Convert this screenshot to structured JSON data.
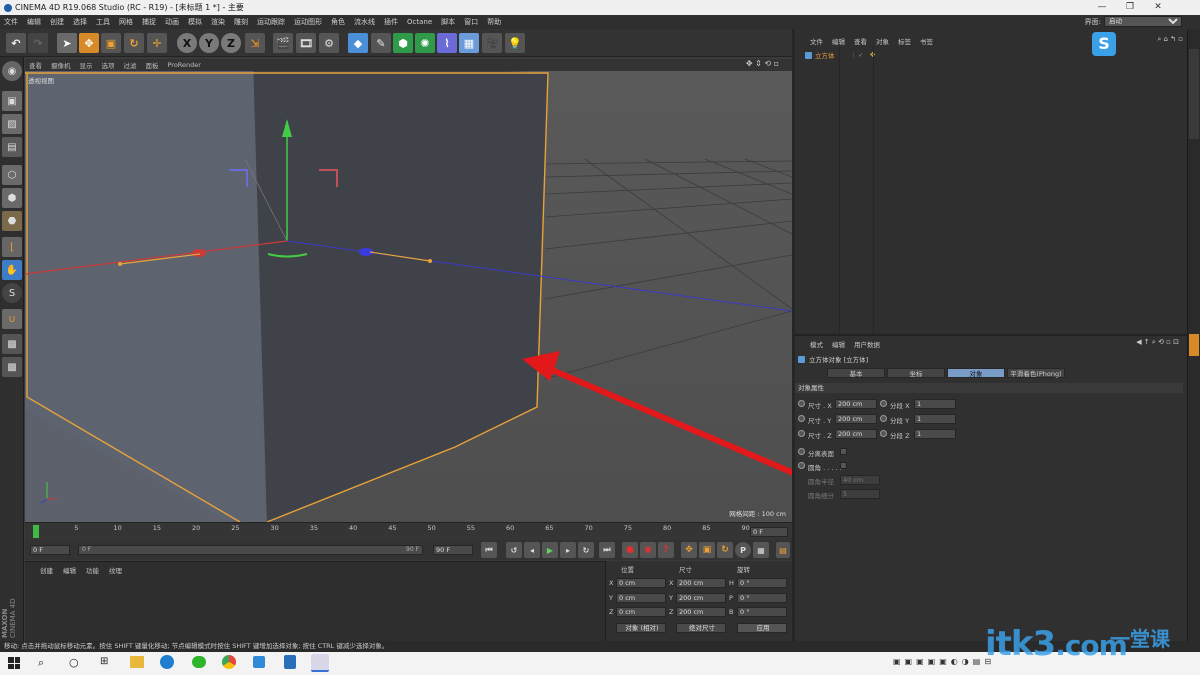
{
  "window": {
    "title": "CINEMA 4D R19.068 Studio (RC - R19) - [未标题 1 *] - 主要"
  },
  "menu": {
    "items": [
      "文件",
      "编辑",
      "创建",
      "选择",
      "工具",
      "网格",
      "捕捉",
      "动画",
      "模拟",
      "渲染",
      "雕刻",
      "运动跟踪",
      "运动图形",
      "角色",
      "流水线",
      "插件",
      "Octane",
      "脚本",
      "窗口",
      "帮助"
    ],
    "interface_label": "界面:",
    "interface_value": "启动"
  },
  "viewport": {
    "menu": [
      "查看",
      "摄像机",
      "显示",
      "选项",
      "过滤",
      "面板",
      "ProRender"
    ],
    "name": "透视视图",
    "grid_label": "网格间距 : 100 cm"
  },
  "timeline": {
    "ticks": [
      "0",
      "5",
      "10",
      "15",
      "20",
      "25",
      "30",
      "35",
      "40",
      "45",
      "50",
      "55",
      "60",
      "65",
      "70",
      "75",
      "80",
      "85",
      "90"
    ],
    "current_frame": "0 F",
    "start_field": "0 F",
    "range_start": "0 F",
    "range_end": "90 F",
    "end_field": "90 F"
  },
  "material": {
    "menu": [
      "创建",
      "编辑",
      "功能",
      "纹理"
    ]
  },
  "coords": {
    "headers": [
      "位置",
      "尺寸",
      "旋转"
    ],
    "rows": [
      {
        "axis": "X",
        "pos": "0 cm",
        "size_axis": "X",
        "size": "200 cm",
        "rot_axis": "H",
        "rot": "0 °"
      },
      {
        "axis": "Y",
        "pos": "0 cm",
        "size_axis": "Y",
        "size": "200 cm",
        "rot_axis": "P",
        "rot": "0 °"
      },
      {
        "axis": "Z",
        "pos": "0 cm",
        "size_axis": "Z",
        "size": "200 cm",
        "rot_axis": "B",
        "rot": "0 °"
      }
    ],
    "mode_select": "对象 (相对)",
    "size_select": "绝对尺寸",
    "apply": "应用"
  },
  "object_manager": {
    "menu": [
      "文件",
      "编辑",
      "查看",
      "对象",
      "标签",
      "书签"
    ],
    "object_name": "立方体"
  },
  "attributes": {
    "menu": [
      "模式",
      "编辑",
      "用户数据"
    ],
    "object_title": "立方体对象 [立方体]",
    "tabs": [
      "基本",
      "坐标",
      "对象",
      "平滑着色(Phong)"
    ],
    "active_tab": 2,
    "section": "对象属性",
    "size_rows": [
      {
        "label": "尺寸 . X",
        "value": "200 cm",
        "seg_label": "分段 X",
        "seg": "1"
      },
      {
        "label": "尺寸 . Y",
        "value": "200 cm",
        "seg_label": "分段 Y",
        "seg": "1"
      },
      {
        "label": "尺寸 . Z",
        "value": "200 cm",
        "seg_label": "分段 Z",
        "seg": "1"
      }
    ],
    "separate_surfaces": "分离表面",
    "fillet": "圆角 . . . . .",
    "fillet_radius": "圆角半径",
    "fillet_radius_value": "40 cm",
    "fillet_subdiv": "圆角细分",
    "fillet_subdiv_value": "5"
  },
  "status": {
    "text": "移动: 点击并拖动鼠标移动元素。按住 SHIFT 键量化移动; 节点编辑模式时按住 SHIFT 键增加选择对象; 按住 CTRL 键减少选择对象。"
  },
  "watermark": {
    "text": "itk3",
    "suffix": ".com",
    "cn": "一堂课"
  },
  "logo": {
    "text1": "MAXON",
    "text2": "CINEMA 4D"
  },
  "colors": {
    "selection_orange": "#e8a23a",
    "arrow_red": "#e3181a",
    "accent_blue": "#5b9bd5"
  }
}
